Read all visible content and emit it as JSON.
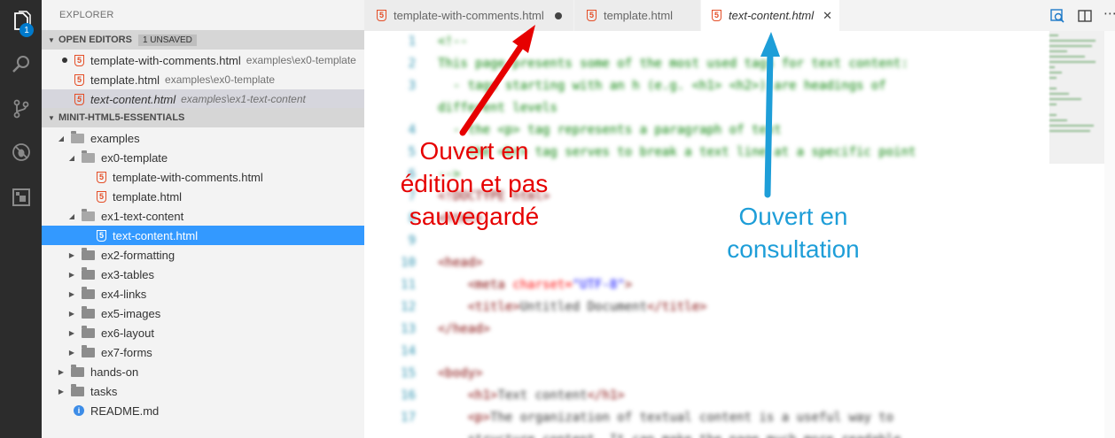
{
  "sidebar": {
    "title": "EXPLORER",
    "open_editors": {
      "header": "OPEN EDITORS",
      "unsaved_badge": "1 UNSAVED",
      "items": [
        {
          "name": "template-with-comments.html",
          "path": "examples\\ex0-template"
        },
        {
          "name": "template.html",
          "path": "examples\\ex0-template"
        },
        {
          "name": "text-content.html",
          "path": "examples\\ex1-text-content"
        }
      ]
    },
    "project": {
      "header": "MINIT-HTML5-ESSENTIALS",
      "tree": [
        "examples",
        "ex0-template",
        "template-with-comments.html",
        "template.html",
        "ex1-text-content",
        "text-content.html",
        "ex2-formatting",
        "ex3-tables",
        "ex4-links",
        "ex5-images",
        "ex6-layout",
        "ex7-forms",
        "hands-on",
        "tasks",
        "README.md"
      ]
    }
  },
  "activity_bar": {
    "icons": [
      "files-icon",
      "search-icon",
      "source-control-icon",
      "debug-icon",
      "extensions-icon"
    ],
    "badge": "1"
  },
  "tabs": [
    {
      "label": "template-with-comments.html",
      "state": "modified"
    },
    {
      "label": "template.html",
      "state": "open"
    },
    {
      "label": "text-content.html",
      "state": "active-preview"
    }
  ],
  "annotations": {
    "red": [
      "Ouvert en",
      "édition et pas",
      "sauvegardé"
    ],
    "blue": [
      "Ouvert en",
      "consultation"
    ]
  },
  "colors": {
    "red_arrow": "#e60000",
    "blue_arrow": "#1e9ed8",
    "selection": "#3399ff"
  }
}
